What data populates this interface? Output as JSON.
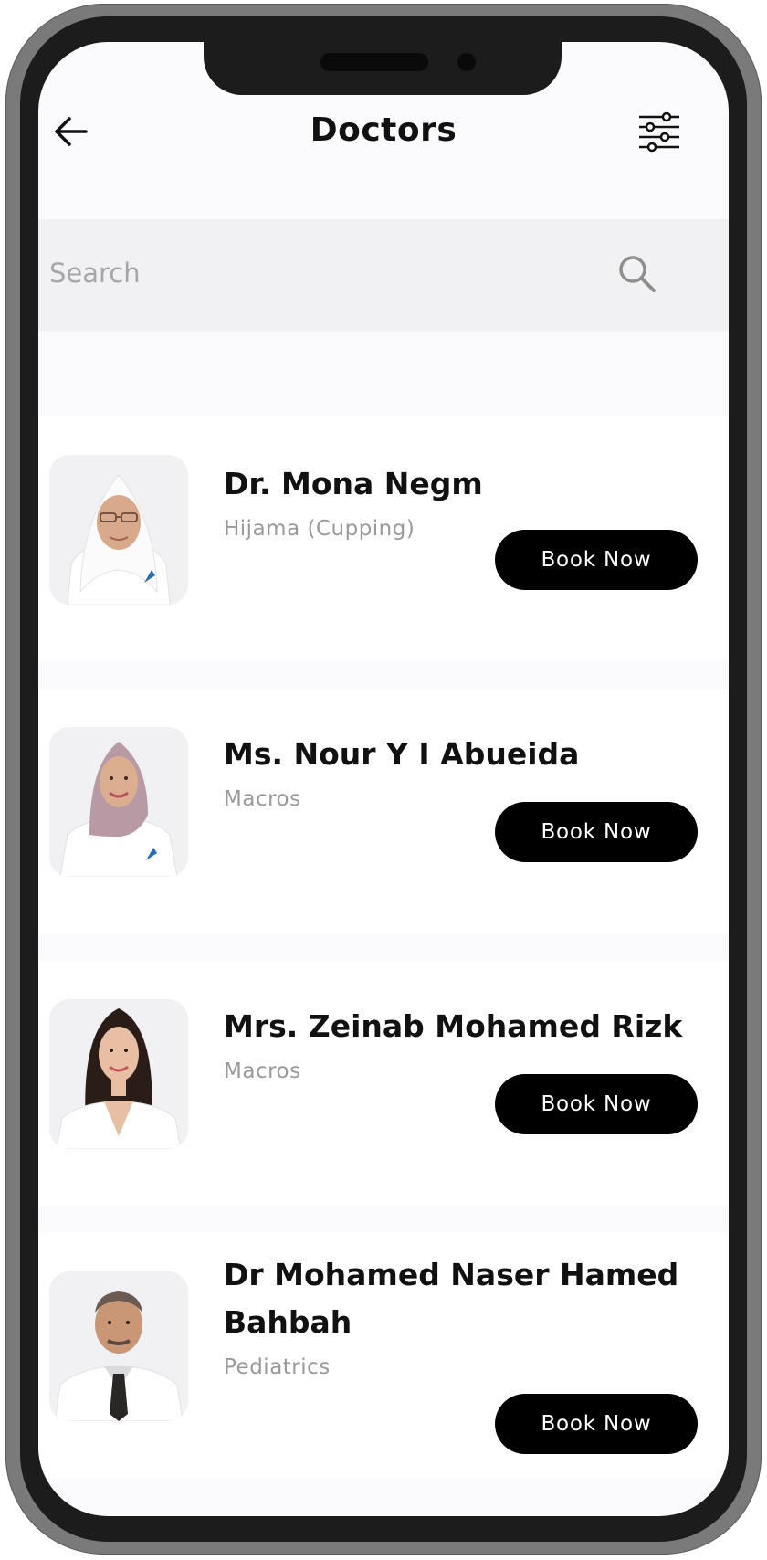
{
  "header": {
    "title": "Doctors",
    "back_icon": "arrow-left-icon",
    "filter_icon": "sliders-icon"
  },
  "search": {
    "placeholder": "Search",
    "value": "",
    "icon": "search-icon"
  },
  "doctors": [
    {
      "name": "Dr. Mona Negm",
      "specialty": "Hijama (Cupping)",
      "button": "Book Now",
      "photo": "female-doctor-white-hijab"
    },
    {
      "name": "Ms. Nour Y I Abueida",
      "specialty": "Macros",
      "button": "Book Now",
      "photo": "female-doctor-mauve-hijab"
    },
    {
      "name": "Mrs. Zeinab Mohamed Rizk",
      "specialty": "Macros",
      "button": "Book Now",
      "photo": "female-doctor-dark-hair"
    },
    {
      "name": "Dr Mohamed Naser Hamed Bahbah",
      "specialty": "Pediatrics",
      "button": "Book Now",
      "photo": "male-doctor-tie"
    }
  ],
  "colors": {
    "accent": "#000000",
    "background": "#fbfafc",
    "card": "#ffffff",
    "search_bg": "#f1f1f3",
    "muted_text": "#9a9a9a"
  }
}
